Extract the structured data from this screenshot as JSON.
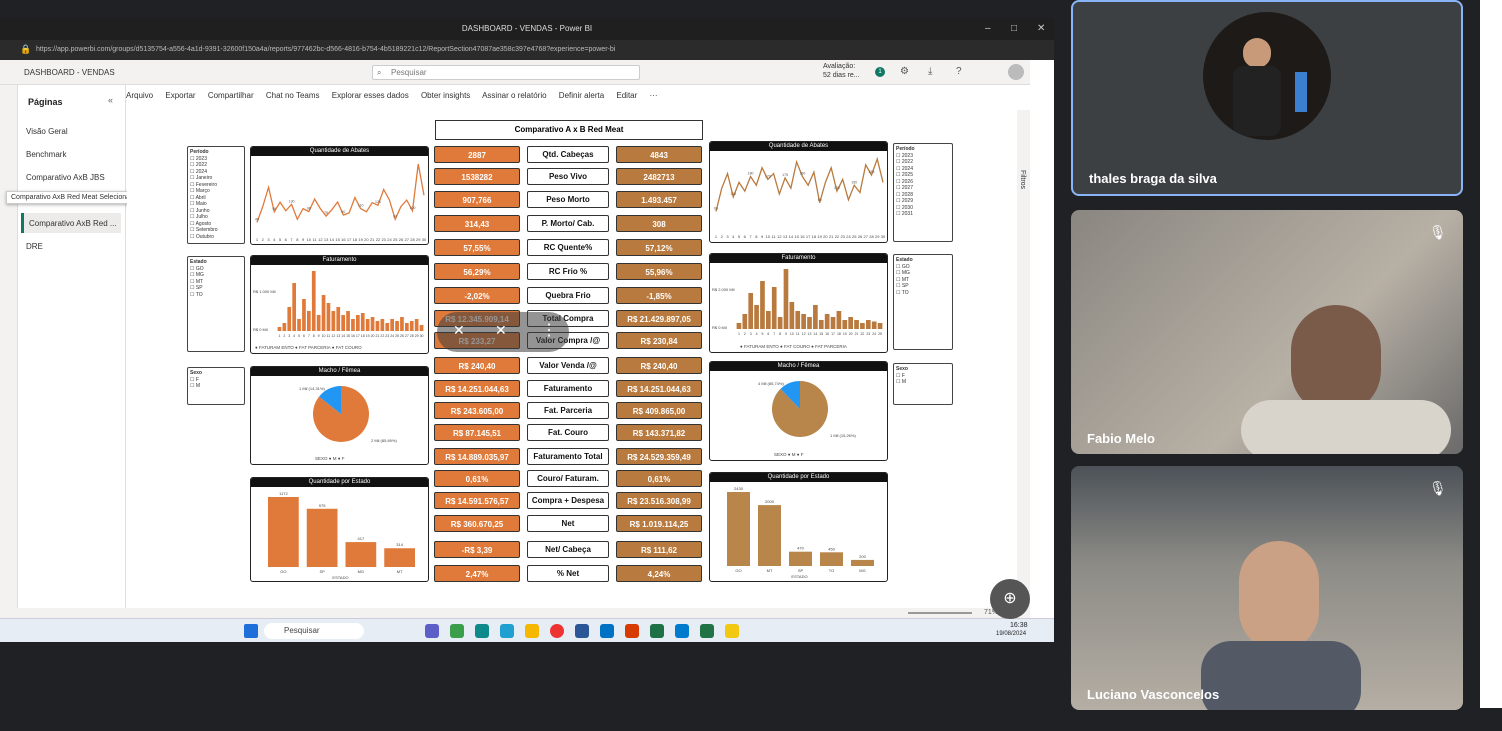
{
  "window": {
    "title": "DASHBOARD - VENDAS - Power BI",
    "url": "https://app.powerbi.com/groups/d5135754-a556-4a1d-9391-32600f150a4a/reports/977462bc-d566-4816-b754-4b5189221c12/ReportSection47087ae358c397e4768?experience=power-bi"
  },
  "header": {
    "report_name": "DASHBOARD - VENDAS",
    "search_placeholder": "Pesquisar",
    "trial_line1": "Avaliação:",
    "trial_line2": "52 dias re...",
    "notif_count": "1"
  },
  "toolbar": {
    "items": [
      "Arquivo",
      "Exportar",
      "Compartilhar",
      "Chat no Teams",
      "Explorar esses dados",
      "Obter insights",
      "Assinar o relatório",
      "Definir alerta",
      "Editar",
      "···"
    ]
  },
  "pages": {
    "heading": "Páginas",
    "items": [
      "Visão Geral",
      "Benchmark",
      "Comparativo AxB JBS",
      "Comparativo AxB Red ...",
      "DRE"
    ],
    "tooltip": "Comparativo AxB Red Meat Selecionado"
  },
  "filters_label": "Filtros",
  "comparison": {
    "title": "Comparativo A x B Red Meat",
    "labels": [
      "Qtd. Cabeças",
      "Peso Vivo",
      "Peso Morto",
      "P. Morto/ Cab.",
      "RC Quente%",
      "RC Frio %",
      "Quebra Frio",
      "Total Compra",
      "Valor Compra /@",
      "Valor Venda /@",
      "Faturamento",
      "Fat. Parceria",
      "Fat. Couro",
      "Faturamento Total",
      "Couro/ Faturam.",
      "Compra + Despesa",
      "Net",
      "Net/ Cabeça",
      "% Net"
    ],
    "a_values": [
      "2887",
      "1538282",
      "907,766",
      "314,43",
      "57,55%",
      "56,29%",
      "-2,02%",
      "R$ 12.345.909,14",
      "R$ 233,27",
      "R$ 240,40",
      "R$ 14.251.044,63",
      "R$ 243.605,00",
      "R$ 87.145,51",
      "R$ 14.889.035,97",
      "0,61%",
      "R$ 14.591.576,57",
      "R$ 360.670,25",
      "-R$ 3,39",
      "2,47%"
    ],
    "b_values": [
      "4843",
      "2482713",
      "1.493.457",
      "308",
      "57,12%",
      "55,96%",
      "-1,85%",
      "R$ 21.429.897,05",
      "R$ 230,84",
      "R$ 240,40",
      "R$ 14.251.044,63",
      "R$ 409.865,00",
      "R$ 143.371,82",
      "R$ 24.529.359,49",
      "0,61%",
      "R$ 23.516.308,99",
      "R$ 1.019.114,25",
      "R$ 111,62",
      "4,24%"
    ]
  },
  "charts_a": {
    "abates_title": "Quantidade de Abates",
    "fat_title": "Faturamento",
    "macho_title": "Macho / Fêmea",
    "estado_title": "Quantidade por Estado",
    "fat_legend": "● FATURAM ENTO  ● FAT PARCERIA  ● FAT COURO",
    "macho_legend": "SEXO ● M ● F",
    "estado_axis": "ESTADO"
  },
  "charts_b": {
    "abates_title": "Quantidade de Abates",
    "fat_title": "Faturamento",
    "macho_title": "Macho / Fêmea",
    "estado_title": "Quantidade por Estado",
    "fat_legend": "● FATURAM ENTO  ● FAT COURO  ● FAT PARCERIA",
    "macho_legend": "SEXO ● M ● F",
    "estado_axis": "ESTADO"
  },
  "chart_data": [
    {
      "type": "line",
      "title": "Quantidade de Abates",
      "x": [
        "1",
        "2",
        "3",
        "4",
        "5",
        "6",
        "7",
        "8",
        "9",
        "10",
        "11",
        "12",
        "13",
        "14",
        "15",
        "16",
        "17",
        "18",
        "19",
        "20",
        "21",
        "22",
        "23",
        "24",
        "25",
        "26",
        "27",
        "28",
        "29",
        "30"
      ],
      "values": [
        45,
        120,
        210,
        95,
        140,
        100,
        130,
        60,
        110,
        96,
        155,
        110,
        75,
        105,
        141,
        80,
        90,
        162,
        110,
        95,
        138,
        126,
        200,
        150,
        60,
        120,
        150,
        100,
        320,
        173
      ]
    },
    {
      "type": "bar",
      "title": "Faturamento",
      "categories": [
        "1",
        "2",
        "3",
        "4",
        "5",
        "6",
        "7",
        "8",
        "9",
        "10",
        "11",
        "12",
        "13",
        "14",
        "15",
        "16",
        "17",
        "18",
        "19",
        "20",
        "21",
        "22",
        "23",
        "24",
        "25",
        "26",
        "27",
        "28",
        "29",
        "30"
      ],
      "values": [
        0.1,
        0.2,
        0.6,
        1.2,
        0.3,
        0.8,
        0.5,
        1.5,
        0.4,
        0.9,
        0.7,
        0.5,
        0.6,
        0.4,
        0.5,
        0.3,
        0.4,
        0.45,
        0.3,
        0.35,
        0.25,
        0.3,
        0.2,
        0.3,
        0.25,
        0.35,
        0.2,
        0.25,
        0.3,
        0.15
      ],
      "ylabel": "",
      "ytick": [
        "R$ 1.000 Mil",
        "R$ 0 Mil"
      ]
    },
    {
      "type": "pie",
      "title": "Macho / Fêmea",
      "categories": [
        "M",
        "F"
      ],
      "values": [
        85.69,
        14.31
      ],
      "labels": [
        "2 Mil (85,69%)",
        "1 Mil (14,31%)"
      ]
    },
    {
      "type": "bar",
      "title": "Quantidade por Estado",
      "categories": [
        "GO",
        "SP",
        "MG",
        "MT"
      ],
      "values": [
        1172,
        975,
        417,
        314
      ]
    },
    {
      "type": "line",
      "title": "Quantidade de Abates",
      "values": [
        60,
        140,
        190,
        110,
        160,
        130,
        180,
        150,
        210,
        170,
        190,
        120,
        175,
        140,
        230,
        180,
        150,
        195,
        90,
        160,
        210,
        130,
        170,
        100,
        150,
        125,
        220,
        185,
        240,
        160
      ]
    },
    {
      "type": "bar",
      "title": "Faturamento",
      "values": [
        0.2,
        0.5,
        1.2,
        0.8,
        1.6,
        0.6,
        1.4,
        0.4,
        2.0,
        0.9,
        0.6,
        0.5,
        0.4,
        0.8,
        0.3,
        0.5,
        0.4,
        0.6,
        0.3,
        0.4,
        0.3,
        0.2,
        0.3,
        0.25,
        0.2
      ],
      "ytick": [
        "R$ 2.000 Mil",
        "R$ 0 Mil"
      ]
    },
    {
      "type": "pie",
      "title": "Macho / Fêmea",
      "categories": [
        "M",
        "F"
      ],
      "values": [
        87.73,
        12.27
      ],
      "labels": [
        "1 Mil (15,26%)",
        "4 Mil (85,74%)"
      ]
    },
    {
      "type": "bar",
      "title": "Quantidade por Estado",
      "categories": [
        "GO",
        "MT",
        "SP",
        "TO",
        "MG"
      ],
      "values": [
        2430,
        2000,
        470,
        450,
        200
      ]
    }
  ],
  "slicers": {
    "periodo": "Período",
    "estado": "Estado",
    "sexo": "Sexo",
    "years_a": [
      "2023",
      "2022",
      "2024",
      "Janeiro",
      "Fevereiro",
      "Março",
      "Abril",
      "Maio",
      "Junho",
      "Julho",
      "Agosto",
      "Setembro",
      "Outubro"
    ],
    "years_b": [
      "2023",
      "2022",
      "2024",
      "2025",
      "2026",
      "2027",
      "2028",
      "2029",
      "2030",
      "2031"
    ],
    "estados": [
      "GO",
      "MG",
      "MT",
      "SP",
      "TO"
    ],
    "sexo_items": [
      "F",
      "M"
    ]
  },
  "statusbar": {
    "zoom": "71%"
  },
  "taskbar": {
    "search": "Pesquisar",
    "time": "16:38",
    "date": "19/08/2024"
  },
  "participants": [
    {
      "name": "thales braga da silva"
    },
    {
      "name": "Fabio Melo"
    },
    {
      "name": "Luciano Vasconcelos"
    }
  ]
}
